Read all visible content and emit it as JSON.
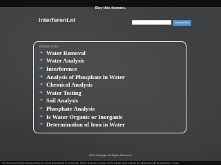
{
  "topbar": {
    "label": "Buy this domain."
  },
  "header": {
    "logo": "interferent.nl",
    "search": {
      "placeholder": "",
      "value": "",
      "button_label": "Search Ads"
    }
  },
  "related": {
    "title": "Related Links",
    "links": [
      {
        "label": "Water Removal"
      },
      {
        "label": "Water Analysis"
      },
      {
        "label": "Interference"
      },
      {
        "label": "Analysis of Phosphate in Water"
      },
      {
        "label": "Chemical Analysis"
      },
      {
        "label": "Water Testing"
      },
      {
        "label": "Soil Analysis"
      },
      {
        "label": "Phosphate Analysis"
      },
      {
        "label": "Is Water Organic or Inorganic"
      },
      {
        "label": "Determination of Iron in Water"
      }
    ]
  },
  "footer": {
    "copyright": "2016 Copyright. All Rights Reserved.",
    "disclaimer": "The Sponsored Listings displayed above are served automatically by a third party. Neither the service provider nor the domain owner maintain any relationship with the advertisers. In case"
  },
  "colors": {
    "background": "#3b3d3e",
    "bar": "#101010",
    "search_button": "#4f97cf",
    "arrow": "#9fd0e8"
  }
}
